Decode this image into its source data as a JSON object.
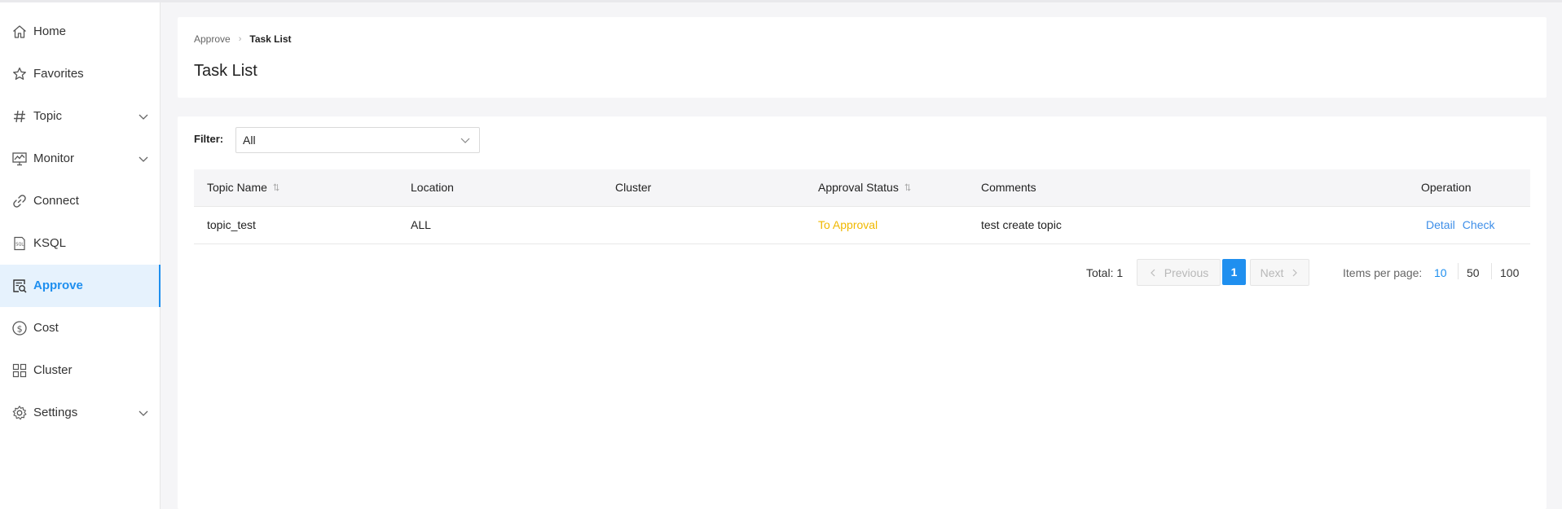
{
  "sidebar": {
    "items": [
      {
        "label": "Home",
        "icon": "home-icon"
      },
      {
        "label": "Favorites",
        "icon": "star-icon"
      },
      {
        "label": "Topic",
        "icon": "hash-icon",
        "expandable": true
      },
      {
        "label": "Monitor",
        "icon": "monitor-icon",
        "expandable": true
      },
      {
        "label": "Connect",
        "icon": "link-icon"
      },
      {
        "label": "KSQL",
        "icon": "sql-file-icon"
      },
      {
        "label": "Approve",
        "icon": "approve-icon",
        "active": true
      },
      {
        "label": "Cost",
        "icon": "dollar-icon"
      },
      {
        "label": "Cluster",
        "icon": "grid-icon"
      },
      {
        "label": "Settings",
        "icon": "gear-icon",
        "expandable": true
      }
    ]
  },
  "header": {
    "breadcrumb": [
      "Approve",
      "Task List"
    ],
    "title": "Task List"
  },
  "filter": {
    "label": "Filter:",
    "value": "All"
  },
  "table": {
    "columns": [
      "Topic Name",
      "Location",
      "Cluster",
      "Approval Status",
      "Comments",
      "Operation"
    ],
    "rows": [
      {
        "topic_name": "topic_test",
        "location": "ALL",
        "cluster": "",
        "approval_status": "To Approval",
        "comments": "test create topic",
        "operations": [
          "Detail",
          "Check"
        ]
      }
    ]
  },
  "pagination": {
    "total": "Total: 1",
    "previous": "Previous",
    "next": "Next",
    "current_page": "1",
    "items_per_page_label": "Items per page:",
    "page_sizes": [
      "10",
      "50",
      "100"
    ],
    "selected_page_size": "10"
  },
  "colors": {
    "accent": "#1f8fef",
    "status_pending": "#f0b800",
    "link": "#3d8ee8"
  }
}
